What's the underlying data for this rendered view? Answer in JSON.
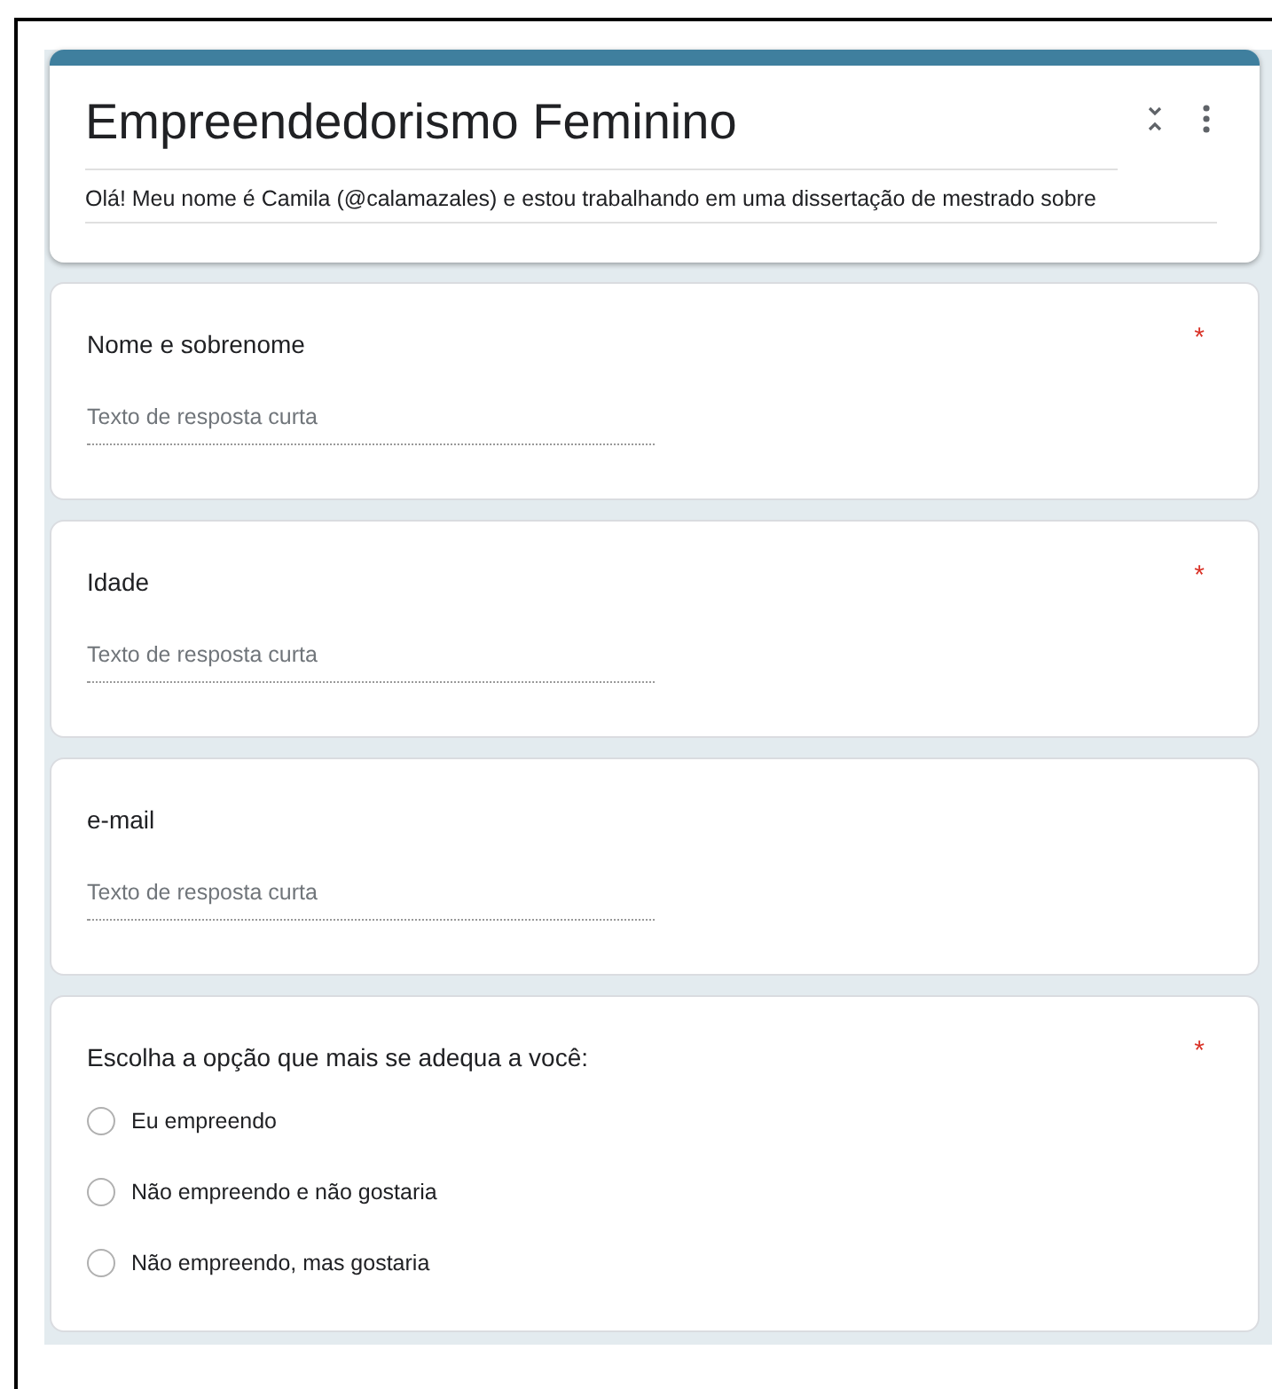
{
  "form": {
    "title": "Empreendedorismo Feminino",
    "description": "Olá! Meu nome é Camila (@calamazales) e estou trabalhando em uma dissertação de mestrado sobre"
  },
  "questions": [
    {
      "kind": "short",
      "title": "Nome e sobrenome",
      "required_mark": "*",
      "placeholder": "Texto de resposta curta"
    },
    {
      "kind": "short",
      "title": "Idade",
      "required_mark": "*",
      "placeholder": "Texto de resposta curta"
    },
    {
      "kind": "short",
      "title": "e-mail",
      "placeholder": "Texto de resposta curta"
    },
    {
      "kind": "choice",
      "title": "Escolha a opção que mais se adequa a você:",
      "required_mark": "*",
      "options": [
        {
          "label": "Eu empreendo",
          "selected": false
        },
        {
          "label": "Não empreendo e não gostaria",
          "selected": false
        },
        {
          "label": "Não empreendo, mas gostaria",
          "selected": false
        }
      ]
    }
  ]
}
